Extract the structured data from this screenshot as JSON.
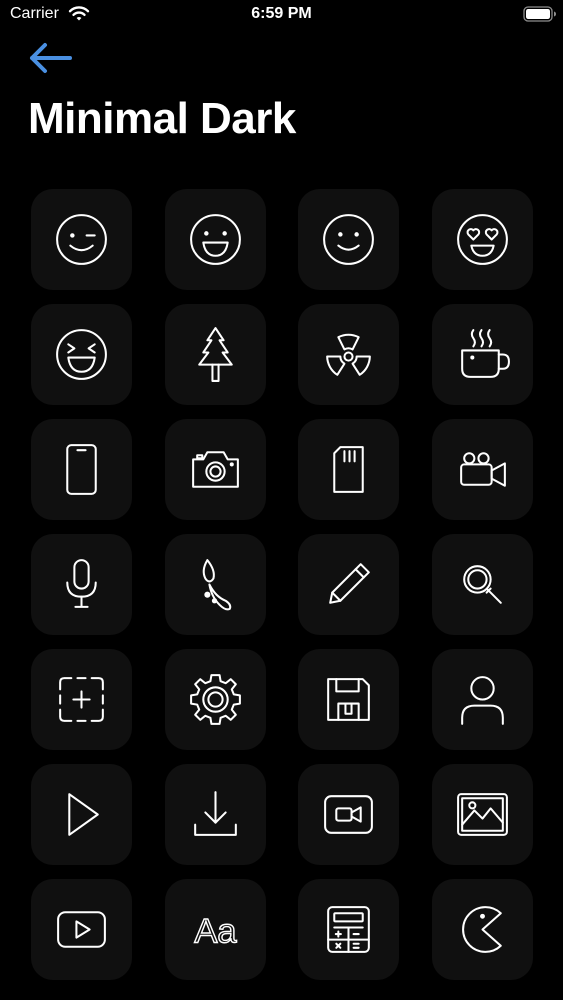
{
  "status_bar": {
    "carrier": "Carrier",
    "time": "6:59 PM",
    "wifi_icon": "wifi-icon",
    "battery_icon": "battery-icon"
  },
  "header": {
    "back_icon": "arrow-left-icon",
    "title": "Minimal Dark"
  },
  "colors": {
    "background": "#000000",
    "tile_background": "#101010",
    "icon_stroke": "#ffffff",
    "back_arrow": "#4a90e2"
  },
  "icons": [
    "wink-face-icon",
    "smile-face-icon",
    "slight-smile-face-icon",
    "heart-eyes-face-icon",
    "laughing-face-icon",
    "tree-icon",
    "radioactive-icon",
    "coffee-cup-icon",
    "phone-icon",
    "camera-icon",
    "sd-card-icon",
    "video-camera-icon",
    "microphone-icon",
    "paint-brush-icon",
    "pencil-icon",
    "search-icon",
    "screenshot-add-icon",
    "settings-gear-icon",
    "floppy-disk-icon",
    "user-icon",
    "play-icon",
    "download-icon",
    "video-call-icon",
    "image-gallery-icon",
    "youtube-icon",
    "font-icon",
    "calculator-icon",
    "pacman-icon"
  ],
  "icon_glyph_text": {
    "font_label": "Aa"
  }
}
